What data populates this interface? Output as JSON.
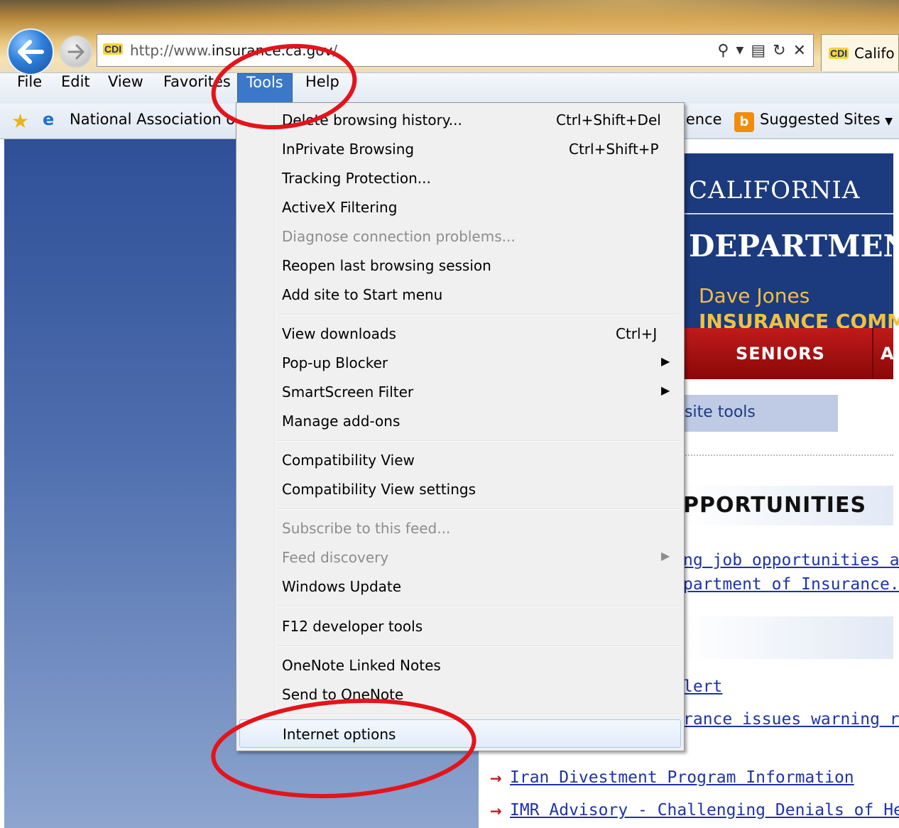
{
  "address": {
    "favicon_text": "CDI",
    "url_prefix": "http://www.",
    "url_host": "insurance.ca.gov",
    "url_suffix": "/"
  },
  "tab": {
    "favicon_text": "CDI",
    "title": "Califo"
  },
  "menubar": {
    "file": "File",
    "edit": "Edit",
    "view": "View",
    "favorites": "Favorites",
    "tools": "Tools",
    "help": "Help"
  },
  "favorites_bar": {
    "item1": "National Association of",
    "item2_partial": "ience",
    "suggested_icon": "b",
    "suggested": "Suggested Sites"
  },
  "tools_menu": {
    "delete_history": "Delete browsing history...",
    "delete_history_shortcut": "Ctrl+Shift+Del",
    "inprivate": "InPrivate Browsing",
    "inprivate_shortcut": "Ctrl+Shift+P",
    "tracking": "Tracking Protection...",
    "activex": "ActiveX Filtering",
    "diagnose": "Diagnose connection problems...",
    "reopen": "Reopen last browsing session",
    "add_start": "Add site to Start menu",
    "view_downloads": "View downloads",
    "view_downloads_shortcut": "Ctrl+J",
    "popup": "Pop-up Blocker",
    "smartscreen": "SmartScreen Filter",
    "addons": "Manage add-ons",
    "compat_view": "Compatibility View",
    "compat_settings": "Compatibility View settings",
    "subscribe": "Subscribe to this feed...",
    "feed_discovery": "Feed discovery",
    "windows_update": "Windows Update",
    "f12": "F12 developer tools",
    "onenote_linked": "OneNote Linked Notes",
    "send_onenote": "Send to OneNote",
    "internet_options": "Internet options"
  },
  "page": {
    "header_state": "CALIFORNIA",
    "header_dept": "DEPARTMEN",
    "header_name": "Dave Jones",
    "header_title": "INSURANCE COMM",
    "nav_seniors": "SENIORS",
    "nav_next": "A",
    "site_tools": "site tools",
    "opportunities": "PPORTUNITIES",
    "link_jobs_1": "ng job opportunities ava",
    "link_jobs_2": "partment of Insurance.",
    "link_alert": "lert",
    "link_warning": "rance issues warning re",
    "link_iran": "Iran Divestment Program Information",
    "link_imr": "IMR Advisory - Challenging Denials of Healt"
  },
  "colors": {
    "menu_highlight": "#3b78c7",
    "annotation_circle": "#e3141b",
    "page_link": "#1f33a8",
    "nav_red": "#c01a1a"
  }
}
